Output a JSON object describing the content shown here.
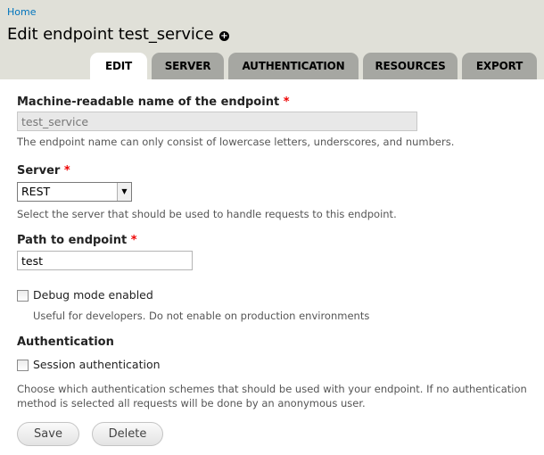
{
  "breadcrumb": "Home",
  "page_title": "Edit endpoint test_service",
  "tabs": [
    {
      "label": "EDIT",
      "active": true
    },
    {
      "label": "SERVER",
      "active": false
    },
    {
      "label": "AUTHENTICATION",
      "active": false
    },
    {
      "label": "RESOURCES",
      "active": false
    },
    {
      "label": "EXPORT",
      "active": false
    }
  ],
  "form": {
    "machine_name": {
      "label": "Machine-readable name of the endpoint",
      "required_marker": "*",
      "value": "test_service",
      "description": "The endpoint name can only consist of lowercase letters, underscores, and numbers."
    },
    "server": {
      "label": "Server",
      "required_marker": "*",
      "selected": "REST",
      "description": "Select the server that should be used to handle requests to this endpoint."
    },
    "path": {
      "label": "Path to endpoint",
      "required_marker": "*",
      "value": "test"
    },
    "debug": {
      "label": "Debug mode enabled",
      "checked": false,
      "description": "Useful for developers. Do not enable on production environments"
    },
    "authentication": {
      "title": "Authentication",
      "session_label": "Session authentication",
      "session_checked": false,
      "description_line1": "Choose which authentication schemes that should be used with your endpoint. If no authentication",
      "description_line2": "method is selected all requests will be done by an anonymous user."
    },
    "save_label": "Save",
    "delete_label": "Delete"
  },
  "colors": {
    "header_bg": "#e0e0d8",
    "tab_inactive": "#a6a7a2",
    "link": "#0074bd",
    "required": "#ee0000"
  }
}
